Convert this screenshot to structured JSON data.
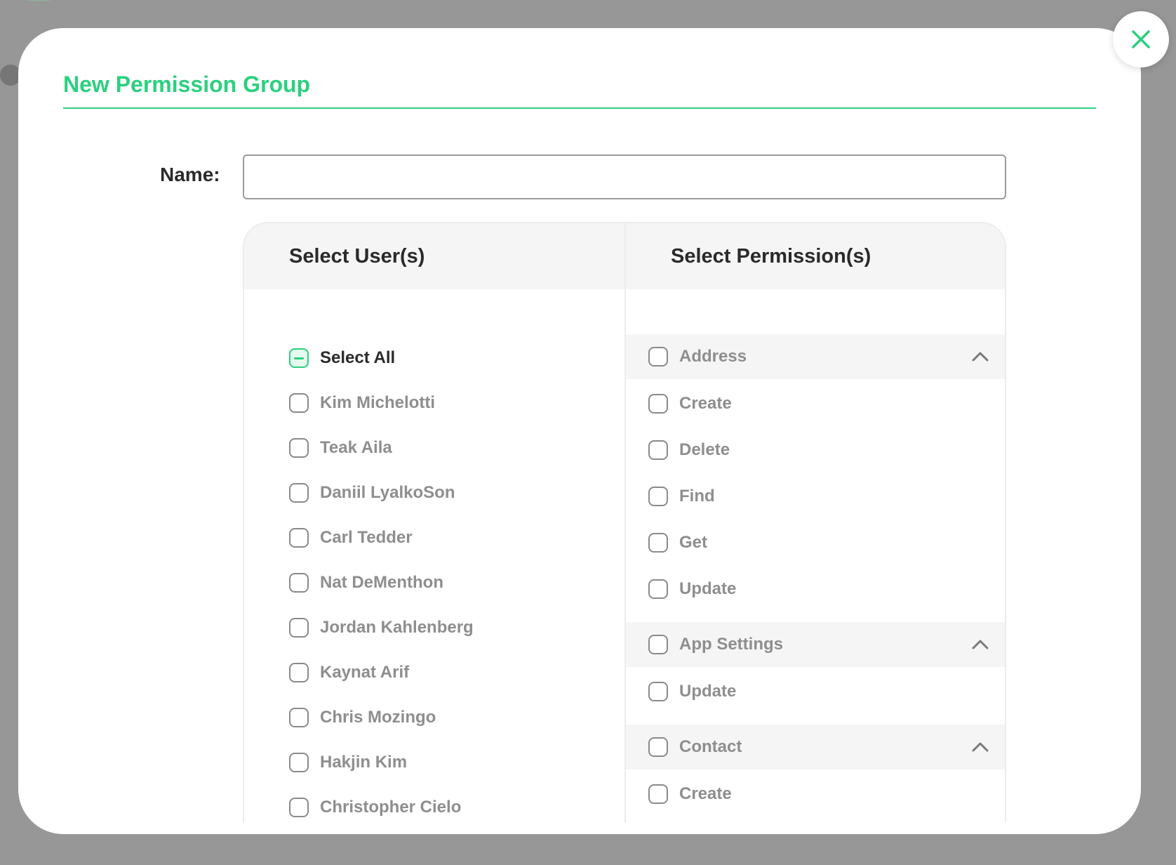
{
  "modal": {
    "title": "New Permission Group"
  },
  "name_field": {
    "label": "Name:",
    "value": "",
    "placeholder": ""
  },
  "users_column": {
    "header": "Select User(s)",
    "select_all_label": "Select All",
    "select_all_state": "indeterminate",
    "users": [
      "Kim Michelotti",
      "Teak Aila",
      "Daniil LyalkoSon",
      "Carl Tedder",
      "Nat DeMenthon",
      "Jordan Kahlenberg",
      "Kaynat Arif",
      "Chris Mozingo",
      "Hakjin Kim",
      "Christopher Cielo"
    ]
  },
  "permissions_column": {
    "header": "Select Permission(s)",
    "groups": [
      {
        "name": "Address",
        "expanded": true,
        "items": [
          "Create",
          "Delete",
          "Find",
          "Get",
          "Update"
        ]
      },
      {
        "name": "App Settings",
        "expanded": true,
        "items": [
          "Update"
        ]
      },
      {
        "name": "Contact",
        "expanded": true,
        "items": [
          "Create"
        ]
      }
    ]
  },
  "colors": {
    "accent": "#2bd07f",
    "overlay": "#979797",
    "muted_text": "#8e8e8e",
    "header_bg": "#f5f5f5"
  },
  "icons": {
    "close": "close-icon",
    "chevron": "chevron-up-icon",
    "indeterminate": "minus-icon"
  }
}
